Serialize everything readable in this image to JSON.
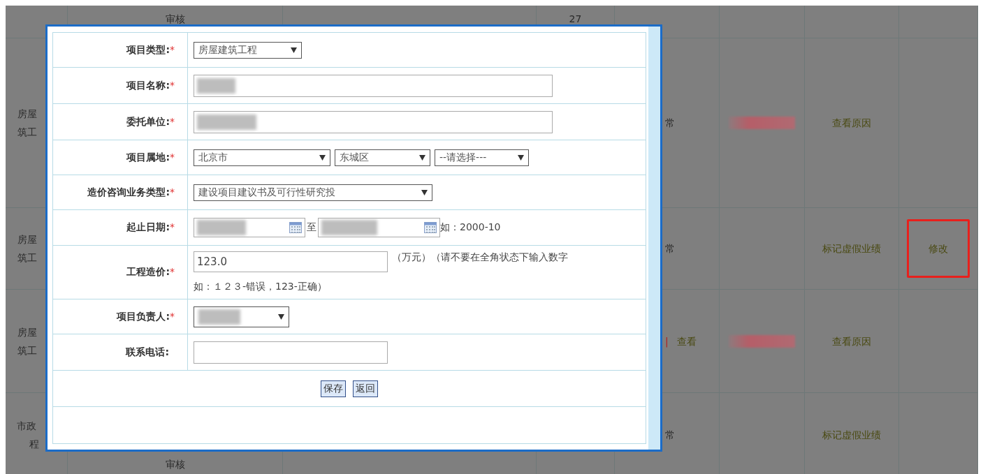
{
  "background_table": {
    "rows": [
      {
        "cells": [
          {},
          {
            "lines": [
              "审核"
            ]
          },
          {},
          {
            "lines": [
              "27"
            ]
          },
          {},
          {},
          {},
          {}
        ]
      },
      {
        "cells": [
          {
            "lines": [
              "房屋",
              "筑工"
            ]
          },
          {},
          {},
          {},
          {
            "lines": [
              "常"
            ]
          },
          {
            "redacted": true
          },
          {
            "link": "查看原因",
            "highlighted": false
          },
          {}
        ]
      },
      {
        "cells": [
          {
            "lines": [
              "房屋",
              "筑工"
            ]
          },
          {},
          {},
          {},
          {
            "lines": [
              "常"
            ]
          },
          {},
          {
            "link": "标记虚假业绩",
            "highlighted": false
          },
          {
            "link": "修改",
            "highlighted": true
          }
        ]
      },
      {
        "cells": [
          {
            "lines": [
              "房屋",
              "筑工"
            ]
          },
          {},
          {},
          {},
          {
            "separator": "|",
            "link": "查看",
            "highlighted": false
          },
          {
            "redacted": true
          },
          {
            "link": "查看原因",
            "highlighted": false
          },
          {}
        ]
      },
      {
        "cells": [
          {
            "lines": [
              "市政",
              "程"
            ]
          },
          {
            "lines": [
              "审核"
            ]
          },
          {},
          {},
          {
            "lines": [
              "常"
            ]
          },
          {},
          {
            "link": "标记虚假业绩",
            "highlighted": false
          },
          {}
        ]
      }
    ]
  },
  "form": {
    "rows": [
      {
        "kind": "type_select",
        "label": "项目类型:",
        "mark": "*",
        "value": "房屋建筑工程"
      },
      {
        "kind": "text_input",
        "label": "项目名称:",
        "mark": "*",
        "redacted": true
      },
      {
        "kind": "text_input",
        "label": "委托单位:",
        "mark": "*",
        "redacted": true
      },
      {
        "kind": "location",
        "label": "项目属地:",
        "mark": "*",
        "selects": [
          "北京市",
          "东城区",
          "--请选择---"
        ]
      },
      {
        "kind": "long_select",
        "label": "造价咨询业务类型:",
        "mark": "*",
        "value": "建设项目建议书及可行性研究投"
      },
      {
        "kind": "date_range",
        "label": "起止日期:",
        "mark": "*",
        "from_redacted": true,
        "separator": "至",
        "to_redacted": true,
        "hint": "如：2000-10"
      },
      {
        "kind": "cost",
        "label": "工程造价:",
        "mark": "*",
        "value": "123.0",
        "hint": [
          "（万元）（请不要在全角状态下输入数字",
          "如：１２３-错误，123-正确）"
        ]
      },
      {
        "kind": "person_select",
        "label": "项目负责人:",
        "mark": "*",
        "redacted": true
      },
      {
        "kind": "phone",
        "label": "联系电话:"
      }
    ],
    "buttons": [
      "保存",
      "返回"
    ]
  }
}
